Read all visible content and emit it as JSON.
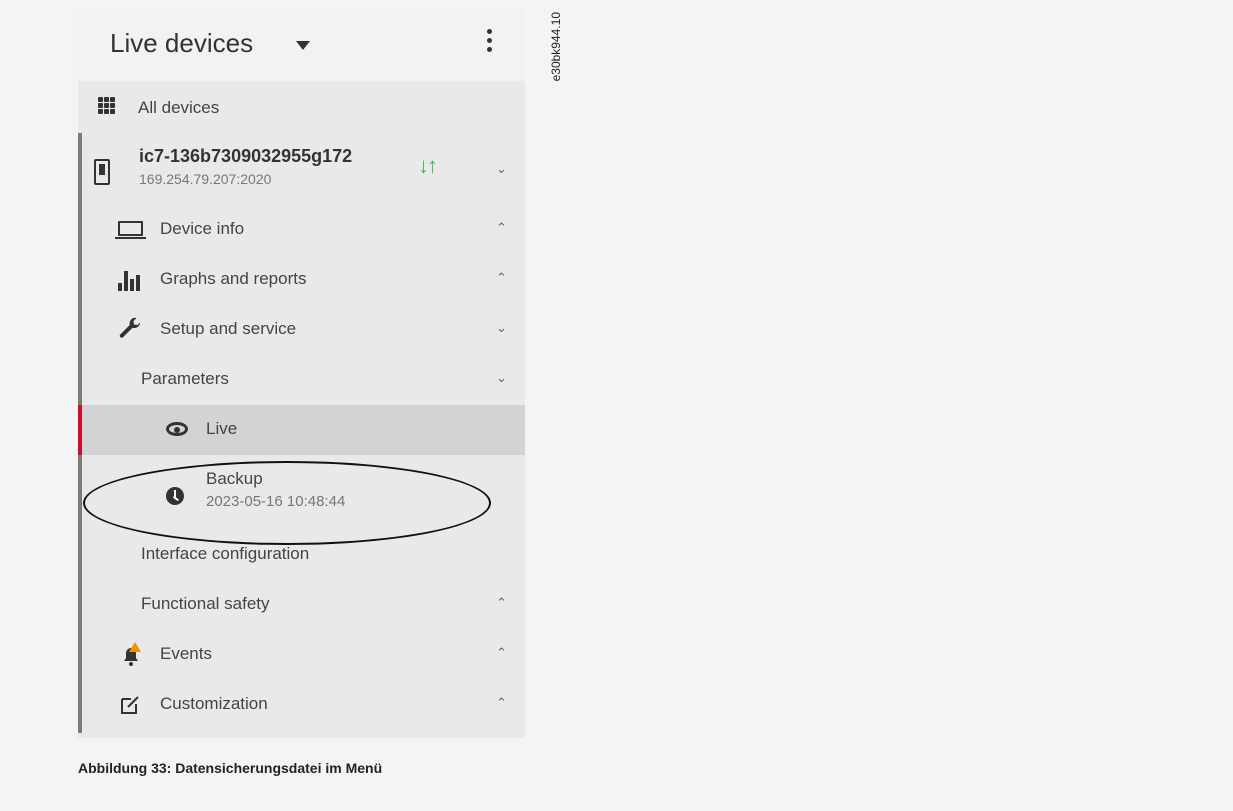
{
  "header": {
    "title": "Live devices",
    "menu_icon": "kebab-icon",
    "dropdown_icon": "caret-down-icon"
  },
  "all_devices": {
    "label": "All devices",
    "icon": "grid-icon"
  },
  "device": {
    "name": "ic7-136b7309032955g172",
    "address": "169.254.79.207:2020",
    "status_icon": "sync-arrows-icon",
    "status_color": "#3fbf3f"
  },
  "menu": {
    "device_info": "Device info",
    "graphs": "Graphs and reports",
    "setup": "Setup and service",
    "parameters": "Parameters",
    "live": "Live",
    "backup": {
      "label": "Backup",
      "timestamp": "2023-05-16 10:48:44"
    },
    "interface": "Interface configuration",
    "functional_safety": "Functional safety",
    "events": "Events",
    "customization": "Customization"
  },
  "chevrons": {
    "down": "⌄",
    "up": "⌃"
  },
  "colors": {
    "accent": "#c8102e",
    "warning": "#f39200"
  },
  "caption": "Abbildung 33: Datensicherungsdatei im Menü",
  "figure_id": "e30bk944.10"
}
